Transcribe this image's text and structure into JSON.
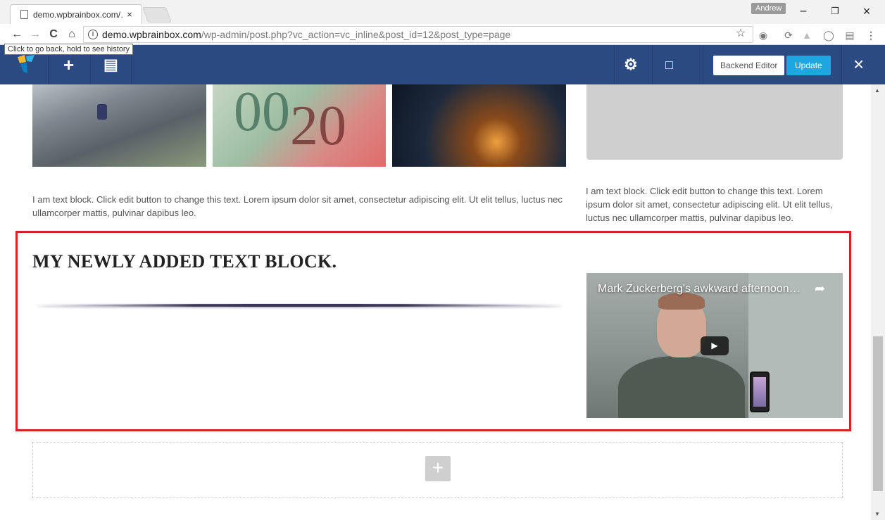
{
  "browser": {
    "tab_title": "demo.wpbrainbox.com/…",
    "tab_close": "×",
    "profile_name": "Andrew",
    "window_controls": {
      "minimize": "–",
      "maximize": "❐",
      "close": "×"
    },
    "url_host": "demo.wpbrainbox.com",
    "url_path": "/wp-admin/post.php?vc_action=vc_inline&post_id=12&post_type=page",
    "tooltip": "Click to go back, hold to see history",
    "nav": {
      "back": "←",
      "forward": "→",
      "reload": "C",
      "home": "⌂"
    },
    "star": "☆"
  },
  "vc_toolbar": {
    "add_icon": "+",
    "layout_icon": "▤",
    "settings_icon": "⚙",
    "device_icon": "□",
    "backend_editor": "Backend Editor",
    "update": "Update",
    "close": "×",
    "colors": {
      "bar": "#2b4a82",
      "update": "#1ea6e0"
    }
  },
  "content": {
    "money_digits_a": "00",
    "money_digits_b": "20",
    "text_block_left": "I am text block. Click edit button to change this text. Lorem ipsum dolor sit amet, consectetur adipiscing elit. Ut elit tellus, luctus nec ullamcorper mattis, pulvinar dapibus leo.",
    "text_block_right": "I am text block. Click edit button to change this text. Lorem ipsum dolor sit amet, consectetur adipiscing elit. Ut elit tellus, luctus nec ullamcorper mattis, pulvinar dapibus leo.",
    "new_heading": "MY NEWLY ADDED TEXT BLOCK.",
    "video_title": "Mark Zuckerberg's awkward afternoon…",
    "video_play": "▶",
    "video_share": "➦",
    "add_element": "+",
    "highlight_color": "#d4232a"
  }
}
